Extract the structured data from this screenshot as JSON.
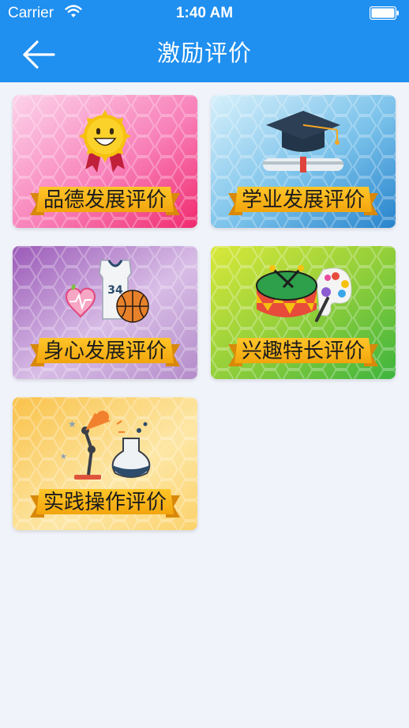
{
  "status_bar": {
    "carrier": "Carrier",
    "time": "1:40 AM"
  },
  "nav": {
    "title": "激励评价",
    "back_icon": "arrow-left-icon"
  },
  "colors": {
    "accent": "#1f8ff0",
    "ribbon": "#f7b21c",
    "background": "#f0f3fa"
  },
  "cards": [
    {
      "label": "品德发展评价",
      "icon": "sun-medal-icon",
      "theme": "pink"
    },
    {
      "label": "学业发展评价",
      "icon": "graduation-cap-icon",
      "theme": "blue"
    },
    {
      "label": "身心发展评价",
      "icon": "heart-jersey-basketball-icon",
      "theme": "purple"
    },
    {
      "label": "兴趣特长评价",
      "icon": "drum-palette-icon",
      "theme": "green"
    },
    {
      "label": "实践操作评价",
      "icon": "lamp-flask-icon",
      "theme": "yellow"
    }
  ]
}
